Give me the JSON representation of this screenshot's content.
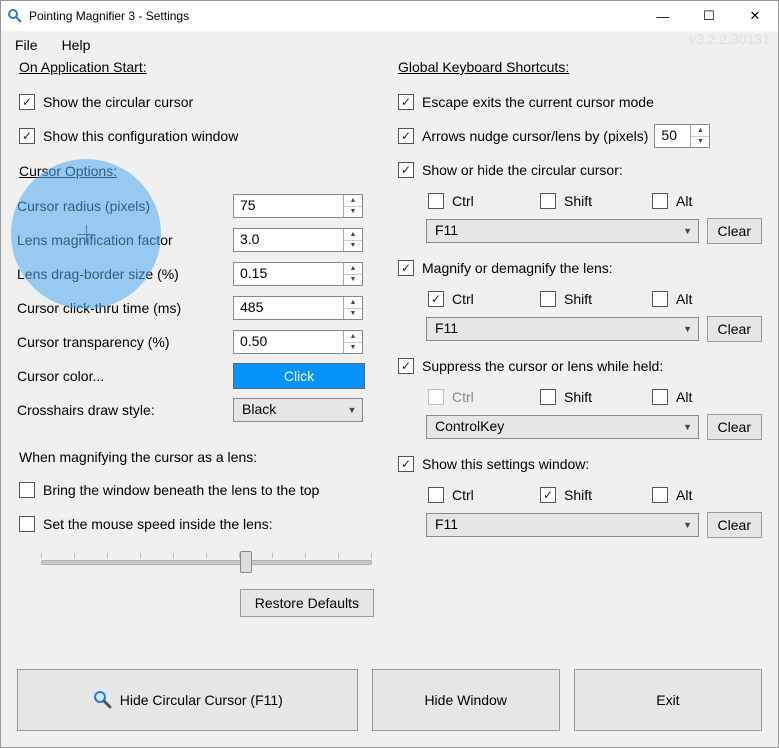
{
  "window": {
    "title": "Pointing Magnifier 3 - Settings",
    "version": "v3.2.2.30131"
  },
  "menu": {
    "file": "File",
    "help": "Help"
  },
  "win_controls": {
    "min": "—",
    "max": "☐",
    "close": "✕"
  },
  "left": {
    "onstart_h": "On Application Start:",
    "show_cursor": "Show the circular cursor",
    "show_config": "Show this configuration window",
    "cursor_h": "Cursor Options:",
    "radius_l": "Cursor radius (pixels)",
    "radius_v": "75",
    "mag_l": "Lens magnification factor",
    "mag_v": "3.0",
    "drag_l": "Lens drag-border size (%)",
    "drag_v": "0.15",
    "click_l": "Cursor click-thru time (ms)",
    "click_v": "485",
    "trans_l": "Cursor transparency (%)",
    "trans_v": "0.50",
    "color_l": "Cursor color...",
    "color_btn": "Click",
    "cross_l": "Crosshairs draw style:",
    "cross_v": "Black",
    "whenmag_h": "When magnifying the cursor as a lens:",
    "bringtop": "Bring the window beneath the lens to the top",
    "setspeed": "Set the mouse speed inside the lens:",
    "restore": "Restore Defaults"
  },
  "right": {
    "global_h": "Global Keyboard Shortcuts:",
    "escape": "Escape exits the current cursor mode",
    "nudge": "Arrows nudge cursor/lens by (pixels)",
    "nudge_v": "50",
    "mods": {
      "ctrl": "Ctrl",
      "shift": "Shift",
      "alt": "Alt"
    },
    "clear": "Clear",
    "g1": {
      "label": "Show or hide the circular cursor:",
      "ctrl": false,
      "shift": false,
      "alt": false,
      "ctrl_disabled": false,
      "key": "F11"
    },
    "g2": {
      "label": "Magnify or demagnify the lens:",
      "ctrl": true,
      "shift": false,
      "alt": false,
      "ctrl_disabled": false,
      "key": "F11"
    },
    "g3": {
      "label": "Suppress the cursor or lens while held:",
      "ctrl": false,
      "shift": false,
      "alt": false,
      "ctrl_disabled": true,
      "key": "ControlKey"
    },
    "g4": {
      "label": "Show this settings window:",
      "ctrl": false,
      "shift": true,
      "alt": false,
      "ctrl_disabled": false,
      "key": "F11"
    }
  },
  "bottom": {
    "hide_cursor": "Hide Circular Cursor (F11)",
    "hide_window": "Hide Window",
    "exit": "Exit"
  }
}
